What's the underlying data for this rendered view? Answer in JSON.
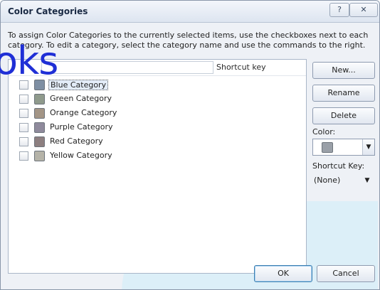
{
  "window": {
    "title": "Color Categories",
    "help_label": "?",
    "close_label": "✕"
  },
  "instructions": "To assign Color Categories to the currently selected items, use the checkboxes next to each category.  To edit a category, select the category name and use the commands to the right.",
  "list": {
    "shortcut_header": "Shortcut key",
    "categories": [
      {
        "label": "Blue Category",
        "color": "#7e8fa3",
        "checked": false,
        "selected": true
      },
      {
        "label": "Green Category",
        "color": "#8f9a8c",
        "checked": false,
        "selected": false
      },
      {
        "label": "Orange Category",
        "color": "#a39586",
        "checked": false,
        "selected": false
      },
      {
        "label": "Purple Category",
        "color": "#8f8a9c",
        "checked": false,
        "selected": false
      },
      {
        "label": "Red Category",
        "color": "#8d7f80",
        "checked": false,
        "selected": false
      },
      {
        "label": "Yellow Category",
        "color": "#b5b3a8",
        "checked": false,
        "selected": false
      }
    ]
  },
  "side": {
    "new_label": "New...",
    "rename_label": "Rename",
    "delete_label": "Delete",
    "color_label": "Color:",
    "color_value": "#9aa0a8",
    "shortcut_label": "Shortcut Key:",
    "shortcut_value": "(None)"
  },
  "footer": {
    "ok_label": "OK",
    "cancel_label": "Cancel"
  },
  "overlay": {
    "text": "oks"
  },
  "colors": {
    "overlay_text": "#1f2fd6",
    "decor_band": "#d6eef8"
  }
}
